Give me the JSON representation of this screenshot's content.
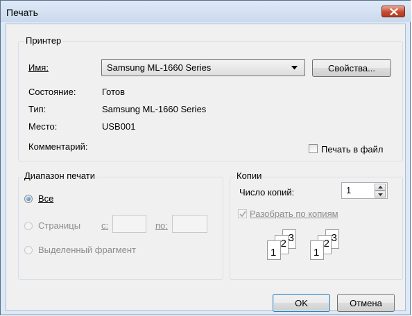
{
  "window": {
    "title": "Печать"
  },
  "printer_group": {
    "legend": "Принтер",
    "name_label": "Имя:",
    "name_value": "Samsung ML-1660 Series",
    "properties_button": "Свойства...",
    "status_label": "Состояние:",
    "status_value": "Готов",
    "type_label": "Тип:",
    "type_value": "Samsung ML-1660 Series",
    "where_label": "Место:",
    "where_value": "USB001",
    "comment_label": "Комментарий:",
    "print_to_file_label": "Печать в файл",
    "print_to_file_checked": false
  },
  "range_group": {
    "legend": "Диапазон печати",
    "all_label": "Все",
    "all_selected": true,
    "pages_label": "Страницы",
    "from_label": "с:",
    "from_value": "",
    "to_label": "по:",
    "to_value": "",
    "selection_label": "Выделенный фрагмент"
  },
  "copies_group": {
    "legend": "Копии",
    "count_label": "Число копий:",
    "count_value": "1",
    "collate_label": "Разобрать по копиям",
    "collate_checked": true,
    "collate_pages": [
      "1",
      "2",
      "3",
      "1",
      "2",
      "3"
    ]
  },
  "buttons": {
    "ok": "OK",
    "cancel": "Отмена"
  },
  "colors": {
    "title_bar": "#cad9ec",
    "close_button": "#c54a30",
    "dialog_body": "#f0f0f0",
    "radio_dot": "#1d64b8"
  }
}
